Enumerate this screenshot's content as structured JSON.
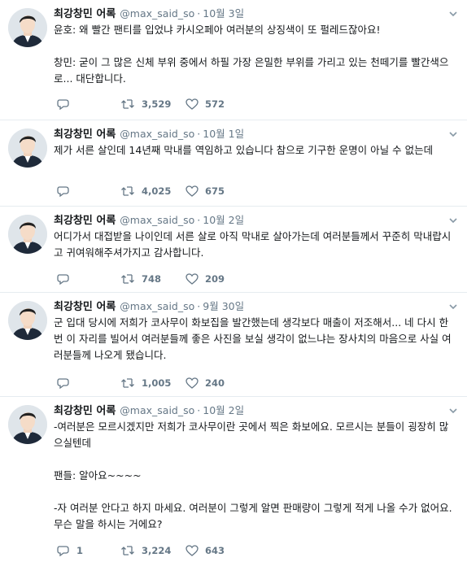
{
  "tweets": [
    {
      "name": "최강창민 어록",
      "handle": "@max_said_so",
      "sep": "·",
      "date": "10월 3일",
      "text": [
        "윤호: 왜 빨간 팬티를 입었냐 카시오페아 여러분의 상징색이 또 펄레드잖아요!",
        "",
        "창민: 굳이 그 많은 신체 부위 중에서 하필 가장 은밀한 부위를 가리고 있는 천떼기를 빨간색으로... 대단합니다."
      ],
      "replies": "",
      "retweets": "3,529",
      "likes": "572"
    },
    {
      "name": "최강창민 어록",
      "handle": "@max_said_so",
      "sep": "·",
      "date": "10월 1일",
      "text": [
        "제가 서른 살인데 14년째 막내를 역임하고 있습니다 참으로 기구한 운명이 아닐 수 없는데"
      ],
      "replies": "",
      "retweets": "4,025",
      "likes": "675"
    },
    {
      "name": "최강창민 어록",
      "handle": "@max_said_so",
      "sep": "·",
      "date": "10월 2일",
      "text": [
        "어디가서 대접받을 나이인데 서른 살로 아직 막내로 살아가는데 여러분들께서 꾸준히 막내랍시고 귀여워해주셔가지고 감사합니다."
      ],
      "replies": "",
      "retweets": "748",
      "likes": "209"
    },
    {
      "name": "최강창민 어록",
      "handle": "@max_said_so",
      "sep": "·",
      "date": "9월 30일",
      "text": [
        "군 입대 당시에 저희가 코사무이 화보집을 발간했는데 생각보다 매출이 저조해서... 네 다시 한 번 이 자리를 빌어서 여러분들께 좋은 사진을 보실 생각이 없느냐는 장사치의 마음으로 사실 여러분들께 나오게 됐습니다."
      ],
      "replies": "",
      "retweets": "1,005",
      "likes": "240"
    },
    {
      "name": "최강창민 어록",
      "handle": "@max_said_so",
      "sep": "·",
      "date": "10월 2일",
      "text": [
        "-여러분은 모르시겠지만 저희가 코사무이란 곳에서 찍은 화보에요. 모르시는 분들이 굉장히 많으실텐데",
        "",
        "팬들: 알아요~~~~",
        "",
        "-자 여러분 안다고 하지 마세요. 여러분이 그렇게 알면 판매량이 그렇게 적게 나올 수가 없어요. 무슨 말을 하시는 거에요?"
      ],
      "replies": "1",
      "retweets": "3,224",
      "likes": "643"
    }
  ],
  "icons": {
    "reply": "reply-icon",
    "retweet": "retweet-icon",
    "like": "heart-icon",
    "caret": "chevron-down-icon",
    "avatar": "avatar"
  },
  "colors": {
    "text": "#14171a",
    "muted": "#657786",
    "border": "#e6ecf0"
  }
}
